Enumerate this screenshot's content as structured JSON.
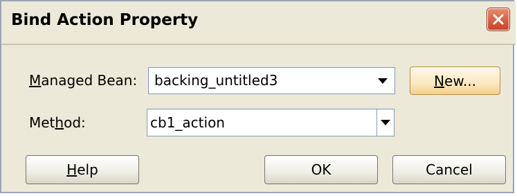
{
  "dialog": {
    "title": "Bind Action Property"
  },
  "form": {
    "managed_bean_label_mnemonic": "M",
    "managed_bean_label_rest": "anaged Bean:",
    "managed_bean_value": "backing_untitled3",
    "new_button_mnemonic": "N",
    "new_button_rest": "ew...",
    "method_label_pre": "Met",
    "method_label_mnemonic": "h",
    "method_label_post": "od:",
    "method_value": "cb1_action"
  },
  "buttons": {
    "help_mnemonic": "H",
    "help_rest": "elp",
    "ok_label": "OK",
    "cancel_label": "Cancel"
  },
  "icons": {
    "close": "close-icon",
    "dropdown": "chevron-down-icon"
  },
  "colors": {
    "dialog_background": "#ece9d8",
    "close_button": "#c4432a",
    "input_border": "#7f9db9",
    "new_button_highlight": "#f4cf8c"
  }
}
